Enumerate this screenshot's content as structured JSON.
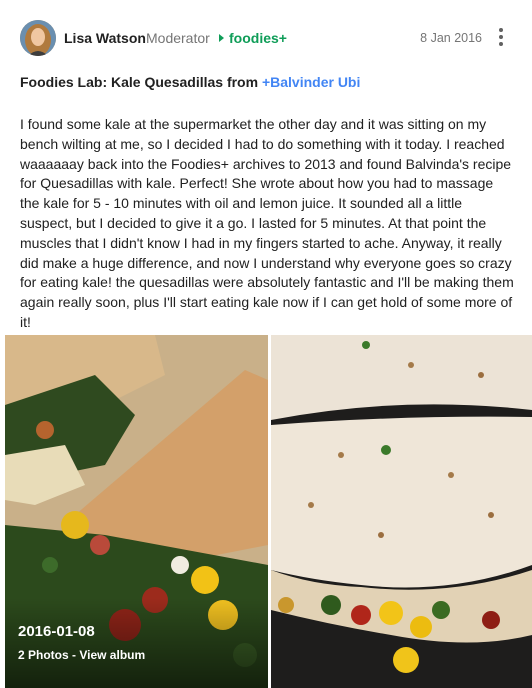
{
  "post": {
    "author_name": "Lisa Watson",
    "author_role": "Moderator",
    "community": "foodies+",
    "date": "8 Jan 2016",
    "menu_icon": "more-vert-icon",
    "title_prefix": "Foodies Lab: Kale Quesadillas from ",
    "title_mention": "+Balvinder Ubi",
    "body": "I found some kale at the supermarket the other day and it was sitting on my bench wilting at me, so I decided I had to do something with it today.  I reached waaaaaay back into the Foodies+ archives to 2013 and found Balvinda's recipe for Quesadillas with kale.  Perfect!  She wrote about how you had to massage the kale for 5 - 10 minutes with oil and lemon juice.  It sounded all a little suspect, but I decided to give it a go.  I lasted for 5 minutes.  At that point the muscles that I didn't know I had in my fingers started to ache.  Anyway, it really did make a huge difference, and now I understand why everyone goes so crazy for eating kale!  the quesadillas were absolutely fantastic and I'll be making them again really soon, plus I'll start eating kale now if I can get hold of some more of it!"
  },
  "album": {
    "date": "2016-01-08",
    "count_label": "2 Photos",
    "separator": " - ",
    "view_label": "View album"
  },
  "colors": {
    "community": "#0f9d58",
    "mention": "#4285f4",
    "meta": "#757575"
  }
}
